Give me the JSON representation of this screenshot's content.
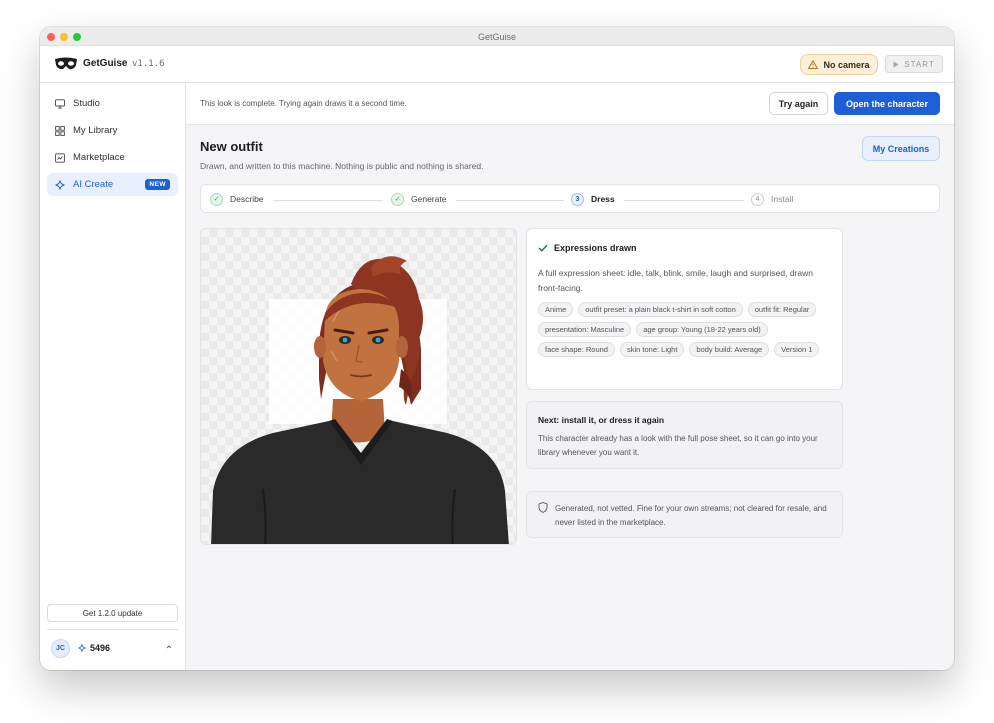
{
  "window": {
    "title": "GetGuise"
  },
  "appbar": {
    "app_name": "GetGuise",
    "version": "v1.1.6",
    "camera_status": "No camera",
    "start_label": "START",
    "colors": {
      "warning_bg": "#fdf0d9",
      "accent": "#1f5fd6"
    }
  },
  "sidebar": {
    "items": [
      {
        "label": "Studio",
        "icon": "monitor-icon"
      },
      {
        "label": "My Library",
        "icon": "grid-icon"
      },
      {
        "label": "Marketplace",
        "icon": "store-icon"
      },
      {
        "label": "AI Create",
        "icon": "sparkle-icon",
        "badge": "NEW",
        "active": true
      }
    ],
    "update_label": "Get 1.2.0 update",
    "user": {
      "initials": "JC",
      "credits": "5496"
    }
  },
  "banner": {
    "text": "This look is complete. Trying again draws it a second time.",
    "try_again_label": "Try again",
    "open_label": "Open the character"
  },
  "page": {
    "title": "New outfit",
    "subtitle": "Drawn, and written to this machine. Nothing is public and nothing is shared.",
    "my_creations_label": "My Creations"
  },
  "stepper": {
    "steps": [
      {
        "num": "1",
        "label": "Describe",
        "state": "done"
      },
      {
        "num": "2",
        "label": "Generate",
        "state": "done"
      },
      {
        "num": "3",
        "label": "Dress",
        "state": "current"
      },
      {
        "num": "4",
        "label": "Install",
        "state": "todo"
      }
    ]
  },
  "expressions": {
    "title": "Expressions drawn",
    "description": "A full expression sheet: idle, talk, blink, smile, laugh and surprised, drawn front-facing.",
    "tags": [
      "Anime",
      "outfit preset: a plain black t-shirt in soft cotton",
      "outfit fit: Regular",
      "presentation: Masculine",
      "age group: Young (18-22 years old)",
      "face shape: Round",
      "skin tone: Light",
      "body build: Average",
      "Version 1"
    ]
  },
  "next": {
    "title": "Next: install it, or dress it again",
    "body": "This character already has a look with the full pose sheet, so it can go into your library whenever you want it."
  },
  "note": {
    "body": "Generated, not vetted. Fine for your own streams; not cleared for resale, and never listed in the marketplace."
  }
}
